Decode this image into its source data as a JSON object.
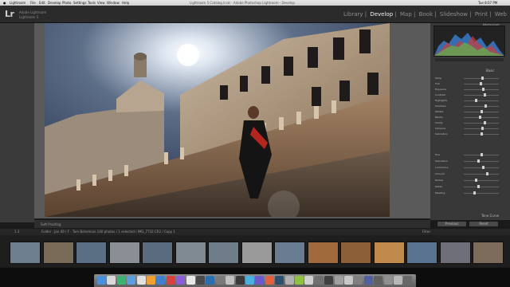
{
  "menubar": {
    "apple": "",
    "items": [
      "Lightroom",
      "File",
      "Edit",
      "Develop",
      "Photo",
      "Settings",
      "Tools",
      "View",
      "Window",
      "Help"
    ],
    "window_title": "Lightroom 5 Catalog.lrcat - Adobe Photoshop Lightroom - Develop",
    "clock": "Tue 8:07 PM"
  },
  "app": {
    "logo": "Lr",
    "name_line1": "Adobe Lightroom",
    "name_line2": "Lightroom 5"
  },
  "modules": [
    "Library",
    "Develop",
    "Map",
    "Book",
    "Slideshow",
    "Print",
    "Web"
  ],
  "active_module": "Develop",
  "right_panel": {
    "histogram_label": "Histogram",
    "basic_label": "Basic",
    "tone_curve_label": "Tone Curve",
    "sliders": [
      {
        "label": "Temp",
        "value": 0.52
      },
      {
        "label": "Tint",
        "value": 0.48
      },
      {
        "label": "Exposure",
        "value": 0.55
      },
      {
        "label": "Contrast",
        "value": 0.6
      },
      {
        "label": "Highlights",
        "value": 0.35
      },
      {
        "label": "Shadows",
        "value": 0.62
      },
      {
        "label": "Whites",
        "value": 0.5
      },
      {
        "label": "Blacks",
        "value": 0.45
      },
      {
        "label": "Clarity",
        "value": 0.58
      },
      {
        "label": "Vibrance",
        "value": 0.53
      },
      {
        "label": "Saturation",
        "value": 0.5
      }
    ],
    "sliders2": [
      {
        "label": "Hue",
        "value": 0.5
      },
      {
        "label": "Saturation",
        "value": 0.4
      },
      {
        "label": "Luminance",
        "value": 0.55
      },
      {
        "label": "Amount",
        "value": 0.65
      },
      {
        "label": "Radius",
        "value": 0.35
      },
      {
        "label": "Detail",
        "value": 0.42
      },
      {
        "label": "Masking",
        "value": 0.3
      }
    ]
  },
  "toolbar": {
    "softproof": "Soft Proofing",
    "previous": "Previous",
    "reset": "Reset"
  },
  "filmstrip_bar": {
    "pages": "1 2",
    "info": "Folder : Jan 09 / F - Tom Bohemian   140 photos / 1 selected / IMG_7732.CR2 / Copy 1",
    "filter": "Filter:"
  },
  "thumbs_count": 15,
  "selected_thumb": 7
}
